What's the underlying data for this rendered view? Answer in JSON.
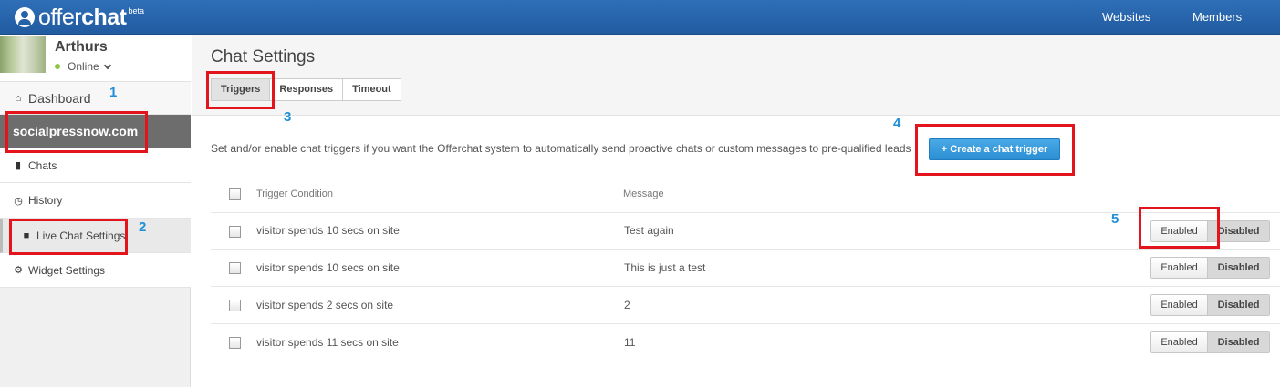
{
  "header": {
    "logo_offer": "offer",
    "logo_chat": "chat",
    "logo_beta": "beta",
    "nav": [
      "Websites",
      "Members"
    ]
  },
  "user": {
    "name": "Arthurs",
    "status": "Online"
  },
  "sidebar": {
    "dashboard": "Dashboard",
    "site": "socialpressnow.com",
    "items": [
      "Chats",
      "History",
      "Live Chat Settings",
      "Widget Settings"
    ]
  },
  "main": {
    "title": "Chat Settings",
    "tabs": [
      "Triggers",
      "Responses",
      "Timeout"
    ],
    "active_tab": "Triggers",
    "description": "Set and/or enable chat triggers if you want the Offerchat system to automatically send proactive chats or custom messages to pre-qualified leads",
    "create_button": "+ Create a chat trigger",
    "columns": [
      "Trigger Condition",
      "Message"
    ],
    "rows": [
      {
        "condition": "visitor spends 10 secs on site",
        "message": "Test again",
        "enabled_label": "Enabled",
        "disabled_label": "Disabled"
      },
      {
        "condition": "visitor spends 10 secs on site",
        "message": "This is just a test",
        "enabled_label": "Enabled",
        "disabled_label": "Disabled"
      },
      {
        "condition": "visitor spends 2 secs on site",
        "message": "2",
        "enabled_label": "Enabled",
        "disabled_label": "Disabled"
      },
      {
        "condition": "visitor spends 11 secs on site",
        "message": "11",
        "enabled_label": "Enabled",
        "disabled_label": "Disabled"
      }
    ]
  },
  "annotations": [
    "1",
    "2",
    "3",
    "4",
    "5"
  ],
  "colors": {
    "topbar": "#2563a8",
    "accent_button": "#2b8fd3",
    "highlight": "#e3141b",
    "annotation_number": "#1e8fd8"
  }
}
